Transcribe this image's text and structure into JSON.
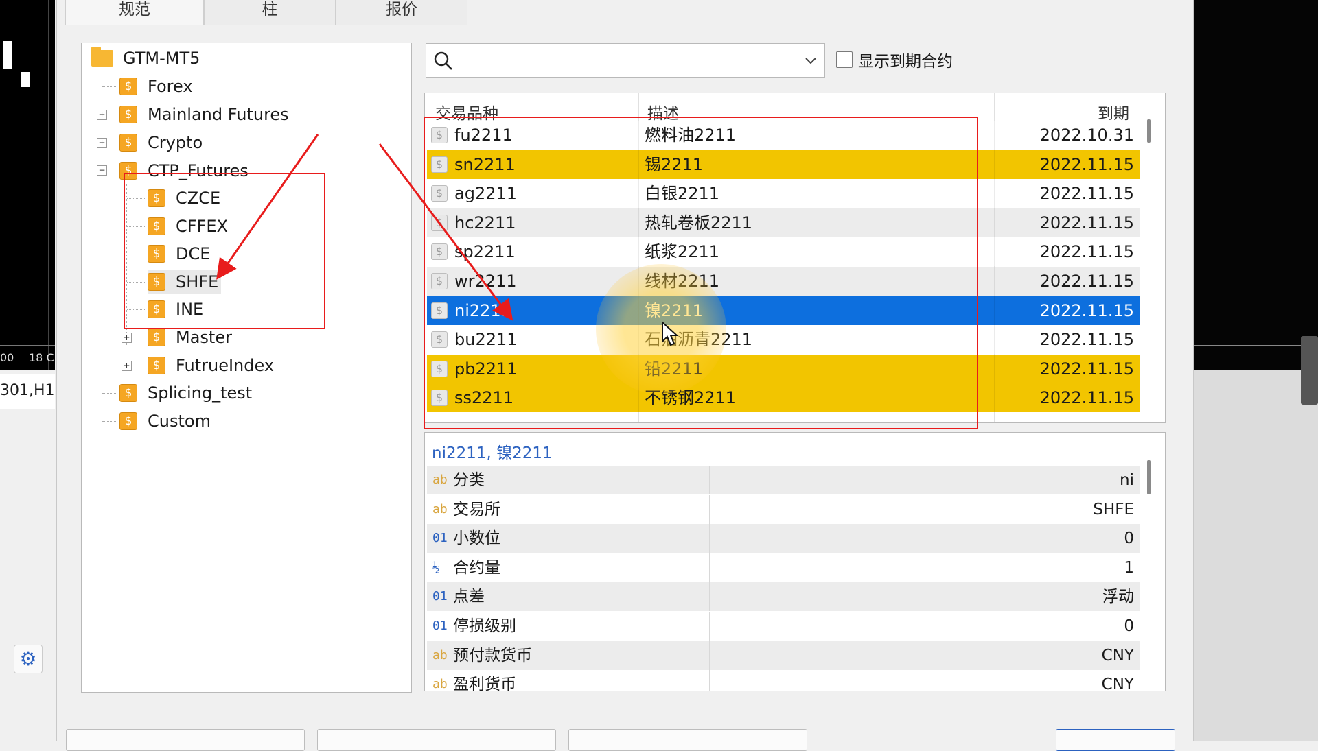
{
  "background": {
    "chart_axis": {
      "label_1": "00",
      "label_2": "18 C",
      "tab_label": "301,H1"
    }
  },
  "tabs": [
    "规范",
    "柱",
    "报价"
  ],
  "tree": {
    "root": "GTM-MT5",
    "items": {
      "forex": "Forex",
      "mainland_futures": "Mainland Futures",
      "crypto": "Crypto",
      "ctp_futures": "CTP_Futures",
      "czce": "CZCE",
      "cffex": "CFFEX",
      "dce": "DCE",
      "shfe": "SHFE",
      "ine": "INE",
      "master": "Master",
      "futrueindex": "FutrueIndex",
      "splicing_test": "Splicing_test",
      "custom": "Custom"
    }
  },
  "search": {
    "value": "",
    "show_expired_label": "显示到期合约",
    "show_expired_checked": false
  },
  "symbols_table": {
    "headers": {
      "symbol": "交易品种",
      "description": "描述",
      "expiry": "到期"
    },
    "rows": [
      {
        "symbol": "fu2211",
        "desc": "燃料油2211",
        "expiry": "2022.10.31",
        "state": "normal"
      },
      {
        "symbol": "sn2211",
        "desc": "锡2211",
        "expiry": "2022.11.15",
        "state": "highlight"
      },
      {
        "symbol": "ag2211",
        "desc": "白银2211",
        "expiry": "2022.11.15",
        "state": "normal"
      },
      {
        "symbol": "hc2211",
        "desc": "热轧卷板2211",
        "expiry": "2022.11.15",
        "state": "alt"
      },
      {
        "symbol": "sp2211",
        "desc": "纸浆2211",
        "expiry": "2022.11.15",
        "state": "normal"
      },
      {
        "symbol": "wr2211",
        "desc": "线材2211",
        "expiry": "2022.11.15",
        "state": "alt"
      },
      {
        "symbol": "ni2211",
        "desc": "镍2211",
        "expiry": "2022.11.15",
        "state": "selected"
      },
      {
        "symbol": "bu2211",
        "desc": "石油沥青2211",
        "expiry": "2022.11.15",
        "state": "normal"
      },
      {
        "symbol": "pb2211",
        "desc": "铅2211",
        "expiry": "2022.11.15",
        "state": "highlight"
      },
      {
        "symbol": "ss2211",
        "desc": "不锈钢2211",
        "expiry": "2022.11.15",
        "state": "highlight"
      }
    ]
  },
  "properties": {
    "title": "ni2211, 镍2211",
    "rows": [
      {
        "icon": "ab",
        "name": "分类",
        "value": "ni"
      },
      {
        "icon": "ab",
        "name": "交易所",
        "value": "SHFE"
      },
      {
        "icon": "01",
        "name": "小数位",
        "value": "0"
      },
      {
        "icon": "½",
        "name": "合约量",
        "value": "1"
      },
      {
        "icon": "01",
        "name": "点差",
        "value": "浮动"
      },
      {
        "icon": "01",
        "name": "停损级别",
        "value": "0"
      },
      {
        "icon": "ab",
        "name": "预付款货币",
        "value": "CNY"
      },
      {
        "icon": "ab",
        "name": "盈利货币",
        "value": "CNY"
      }
    ]
  },
  "colors": {
    "highlight": "#f2c500",
    "selected": "#0d6fde",
    "annotation": "#e81c1c"
  }
}
